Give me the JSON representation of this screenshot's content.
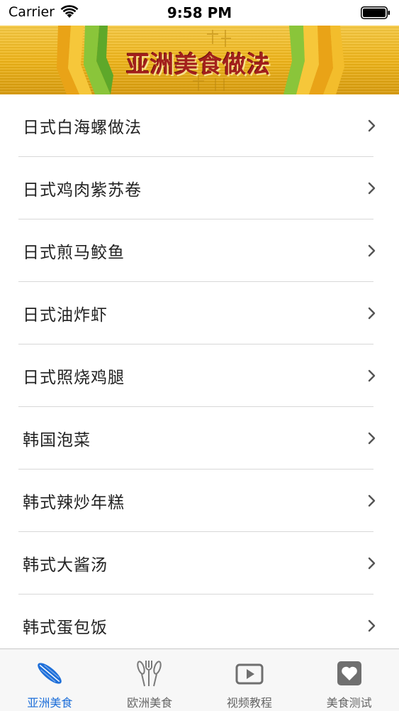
{
  "status_bar": {
    "carrier": "Carrier",
    "time": "9:58 PM"
  },
  "banner": {
    "title": "亚洲美食做法"
  },
  "list": {
    "items": [
      "日式白海螺做法",
      "日式鸡肉紫苏卷",
      "日式煎马鲛鱼",
      "日式油炸虾",
      "日式照烧鸡腿",
      "韩国泡菜",
      "韩式辣炒年糕",
      "韩式大酱汤",
      "韩式蛋包饭"
    ]
  },
  "tab_bar": {
    "tabs": [
      {
        "label": "亚洲美食",
        "icon": "surfboard-icon",
        "active": true
      },
      {
        "label": "欧洲美食",
        "icon": "cutlery-icon",
        "active": false
      },
      {
        "label": "视频教程",
        "icon": "play-icon",
        "active": false
      },
      {
        "label": "美食测试",
        "icon": "heart-icon",
        "active": false
      }
    ]
  },
  "colors": {
    "accent": "#1e6fd9",
    "inactive": "#666666",
    "banner_title": "#a3201c"
  }
}
